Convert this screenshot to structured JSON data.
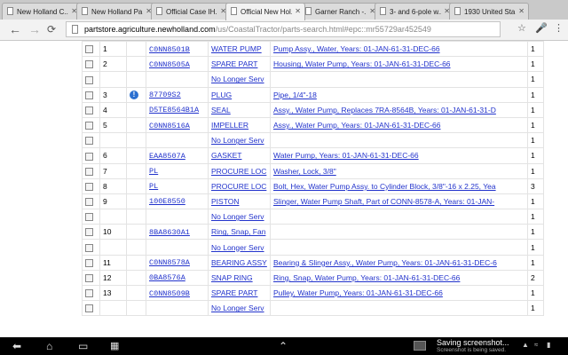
{
  "tabs": [
    {
      "label": "New Holland C...",
      "active": false
    },
    {
      "label": "New Holland Pa...",
      "active": false
    },
    {
      "label": "Official Case IH...",
      "active": false
    },
    {
      "label": "Official New Hol...",
      "active": true
    },
    {
      "label": "Garner Ranch -...",
      "active": false
    },
    {
      "label": "3- and 6-pole w...",
      "active": false
    },
    {
      "label": "1930 United Sta...",
      "active": false
    }
  ],
  "address": {
    "host": "partstore.agriculture.newholland.com",
    "path": "/us/CoastalTractor/parts-search.html#epc::mr55729ar452549"
  },
  "parts": [
    {
      "num": "1",
      "info": false,
      "part": "C0NN8501B",
      "desc": "WATER PUMP",
      "detail": "Pump Assy., Water, Years: 01-JAN-61-31-DEC-66",
      "qty": "1"
    },
    {
      "num": "2",
      "info": false,
      "part": "C0NN8505A",
      "desc": "SPARE PART",
      "detail": "Housing, Water Pump, Years: 01-JAN-61-31-DEC-66",
      "qty": "1"
    },
    {
      "num": "",
      "info": false,
      "part": "",
      "desc": "No Longer Serv",
      "detail": "",
      "qty": "1"
    },
    {
      "num": "3",
      "info": true,
      "part": "87709S2",
      "desc": "PLUG",
      "detail": "Pipe, 1/4\"-18",
      "qty": "1"
    },
    {
      "num": "4",
      "info": false,
      "part": "D5TE8564B1A",
      "desc": "SEAL",
      "detail": "Assy., Water Pump, Replaces 7RA-8564B, Years: 01-JAN-61-31-D",
      "qty": "1"
    },
    {
      "num": "5",
      "info": false,
      "part": "C0NN8516A",
      "desc": "IMPELLER",
      "detail": "Assy., Water Pump, Years: 01-JAN-61-31-DEC-66",
      "qty": "1"
    },
    {
      "num": "",
      "info": false,
      "part": "",
      "desc": "No Longer Serv",
      "detail": "",
      "qty": "1"
    },
    {
      "num": "6",
      "info": false,
      "part": "EAA8507A",
      "desc": "GASKET",
      "detail": "Water Pump, Years: 01-JAN-61-31-DEC-66",
      "qty": "1"
    },
    {
      "num": "7",
      "info": false,
      "part": "PL",
      "desc": "PROCURE LOC",
      "detail": "Washer, Lock, 3/8\"",
      "qty": "1"
    },
    {
      "num": "8",
      "info": false,
      "part": "PL",
      "desc": "PROCURE LOC",
      "detail": "Bolt, Hex, Water Pump Assy. to Cylinder Block, 3/8\"-16 x 2.25, Yea",
      "qty": "3"
    },
    {
      "num": "9",
      "info": false,
      "part": "100E8550",
      "desc": "PISTON",
      "detail": "Slinger, Water Pump Shaft, Part of CONN-8578-A, Years: 01-JAN-",
      "qty": "1"
    },
    {
      "num": "",
      "info": false,
      "part": "",
      "desc": "No Longer Serv",
      "detail": "",
      "qty": "1"
    },
    {
      "num": "10",
      "info": false,
      "part": "8BA8630A1",
      "desc": "Ring, Snap, Fan",
      "detail": "",
      "qty": "1"
    },
    {
      "num": "",
      "info": false,
      "part": "",
      "desc": "No Longer Serv",
      "detail": "",
      "qty": "1"
    },
    {
      "num": "11",
      "info": false,
      "part": "C0NN8578A",
      "desc": "BEARING ASSY",
      "detail": "Bearing & Slinger Assy., Water Pump, Years: 01-JAN-61-31-DEC-6",
      "qty": "1"
    },
    {
      "num": "12",
      "info": false,
      "part": "0BA8576A",
      "desc": "SNAP RING",
      "detail": "Ring, Snap, Water Pump, Years: 01-JAN-61-31-DEC-66",
      "qty": "2"
    },
    {
      "num": "13",
      "info": false,
      "part": "C0NN8509B",
      "desc": "SPARE PART",
      "detail": "Pulley, Water Pump, Years: 01-JAN-61-31-DEC-66",
      "qty": "1"
    },
    {
      "num": "",
      "info": false,
      "part": "",
      "desc": "No Longer Serv",
      "detail": "",
      "qty": "1"
    }
  ],
  "notification": {
    "title": "Saving screenshot...",
    "subtitle": "Screenshot is being saved."
  },
  "icons": {
    "back": "back-arrow-icon",
    "home": "home-icon",
    "recents": "recent-apps-icon",
    "screenshot": "screenshot-icon",
    "up": "chevron-up-icon"
  },
  "colors": {
    "link": "#2233cc",
    "info": "#2a6fd0",
    "navbar": "#000000"
  }
}
